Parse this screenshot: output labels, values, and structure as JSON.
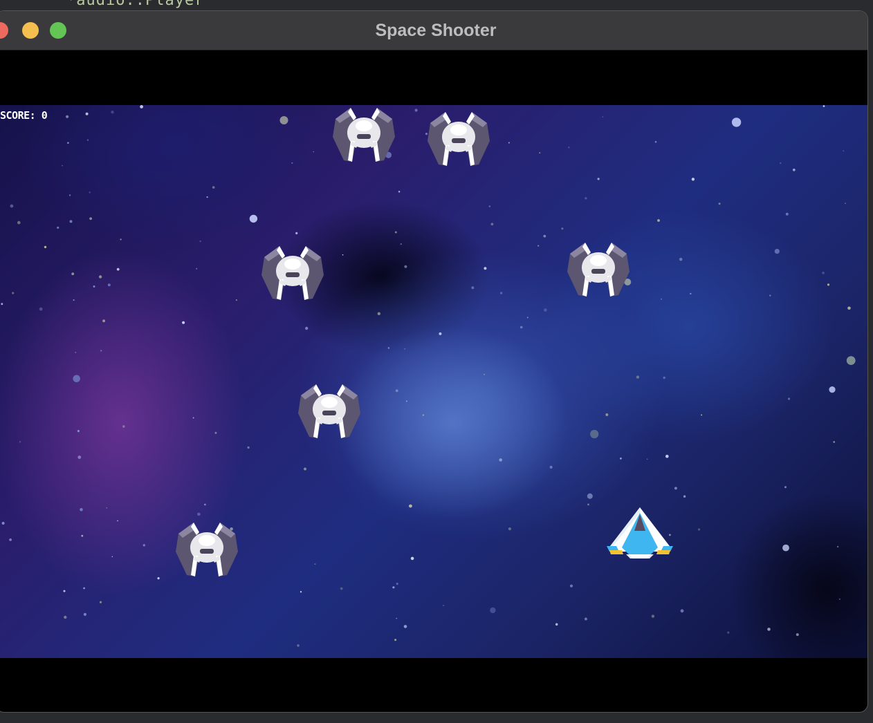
{
  "background": {
    "code_snippet": "*audio::Player"
  },
  "window": {
    "title": "Space Shooter"
  },
  "hud": {
    "score_label": "SCORE: 0"
  },
  "game": {
    "enemy_count": 6,
    "colors": {
      "enemy_body": "#e8e8ec",
      "enemy_wing": "#5d5670",
      "player_body": "#3fb6ef",
      "player_hull": "#ffffff",
      "player_thruster": "#f2c230"
    }
  }
}
